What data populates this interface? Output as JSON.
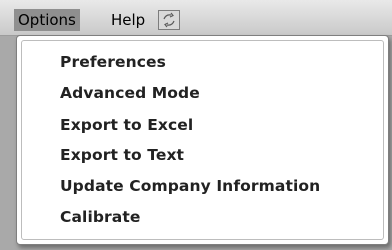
{
  "menubar": {
    "options_label": "Options",
    "help_label": "Help",
    "icon": "sync-icon"
  },
  "options_menu": {
    "items": [
      {
        "label": "Preferences"
      },
      {
        "label": "Advanced Mode"
      },
      {
        "label": "Export to Excel"
      },
      {
        "label": "Export to Text"
      },
      {
        "label": "Update Company Information"
      },
      {
        "label": "Calibrate"
      }
    ]
  }
}
